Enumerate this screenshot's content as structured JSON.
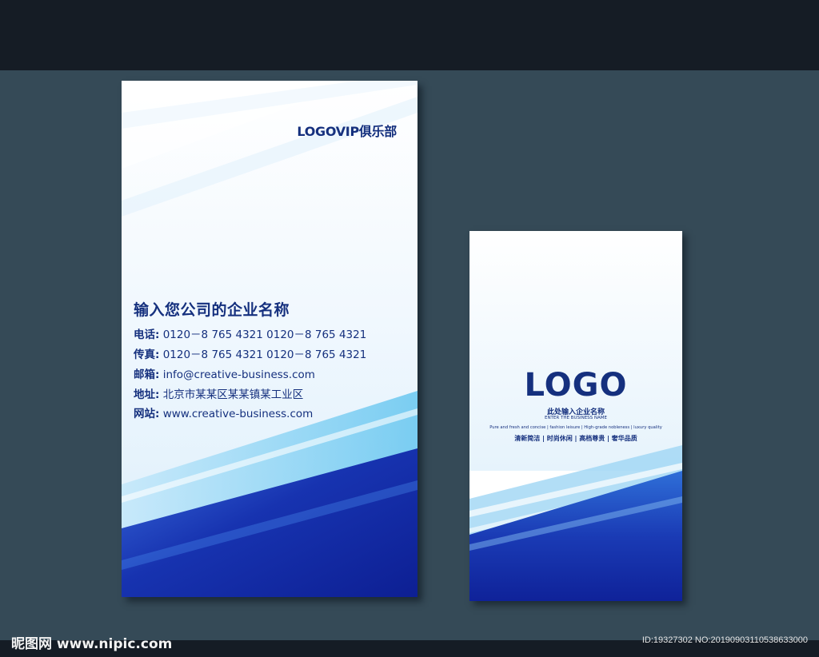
{
  "front_card": {
    "club": "LOGOVIP俱乐部",
    "company_name": "输入您公司的企业名称",
    "lines": [
      {
        "label": "电话:",
        "value": "0120－8 765 4321 0120－8 765 4321"
      },
      {
        "label": "传真:",
        "value": "0120－8 765 4321 0120－8 765 4321"
      },
      {
        "label": "邮箱:",
        "value": "info@creative-business.com"
      },
      {
        "label": "地址:",
        "value": "北京市某某区某某镇某工业区"
      },
      {
        "label": "网站:",
        "value": "www.creative-business.com"
      }
    ]
  },
  "back_card": {
    "logo": "LOGO",
    "name_cn": "此处输入企业名称",
    "name_en": "ENTER THE BUSINESS NAME",
    "tags_en": "Pure and fresh and concise | fashion leisure | High-grade nobleness | luxury quality",
    "tags_cn": "清新简洁 | 时尚休闲 | 高档尊贵 | 奢华品质"
  },
  "watermark": {
    "left": "昵图网 www.nipic.com",
    "right": "ID:19327302 NO:20190903110538633000"
  },
  "colors": {
    "background": "#354a57",
    "band": "#151c25",
    "text_navy": "#15307e",
    "deep_blue": "#1632a8",
    "light_blue": "#5bc0ee"
  }
}
